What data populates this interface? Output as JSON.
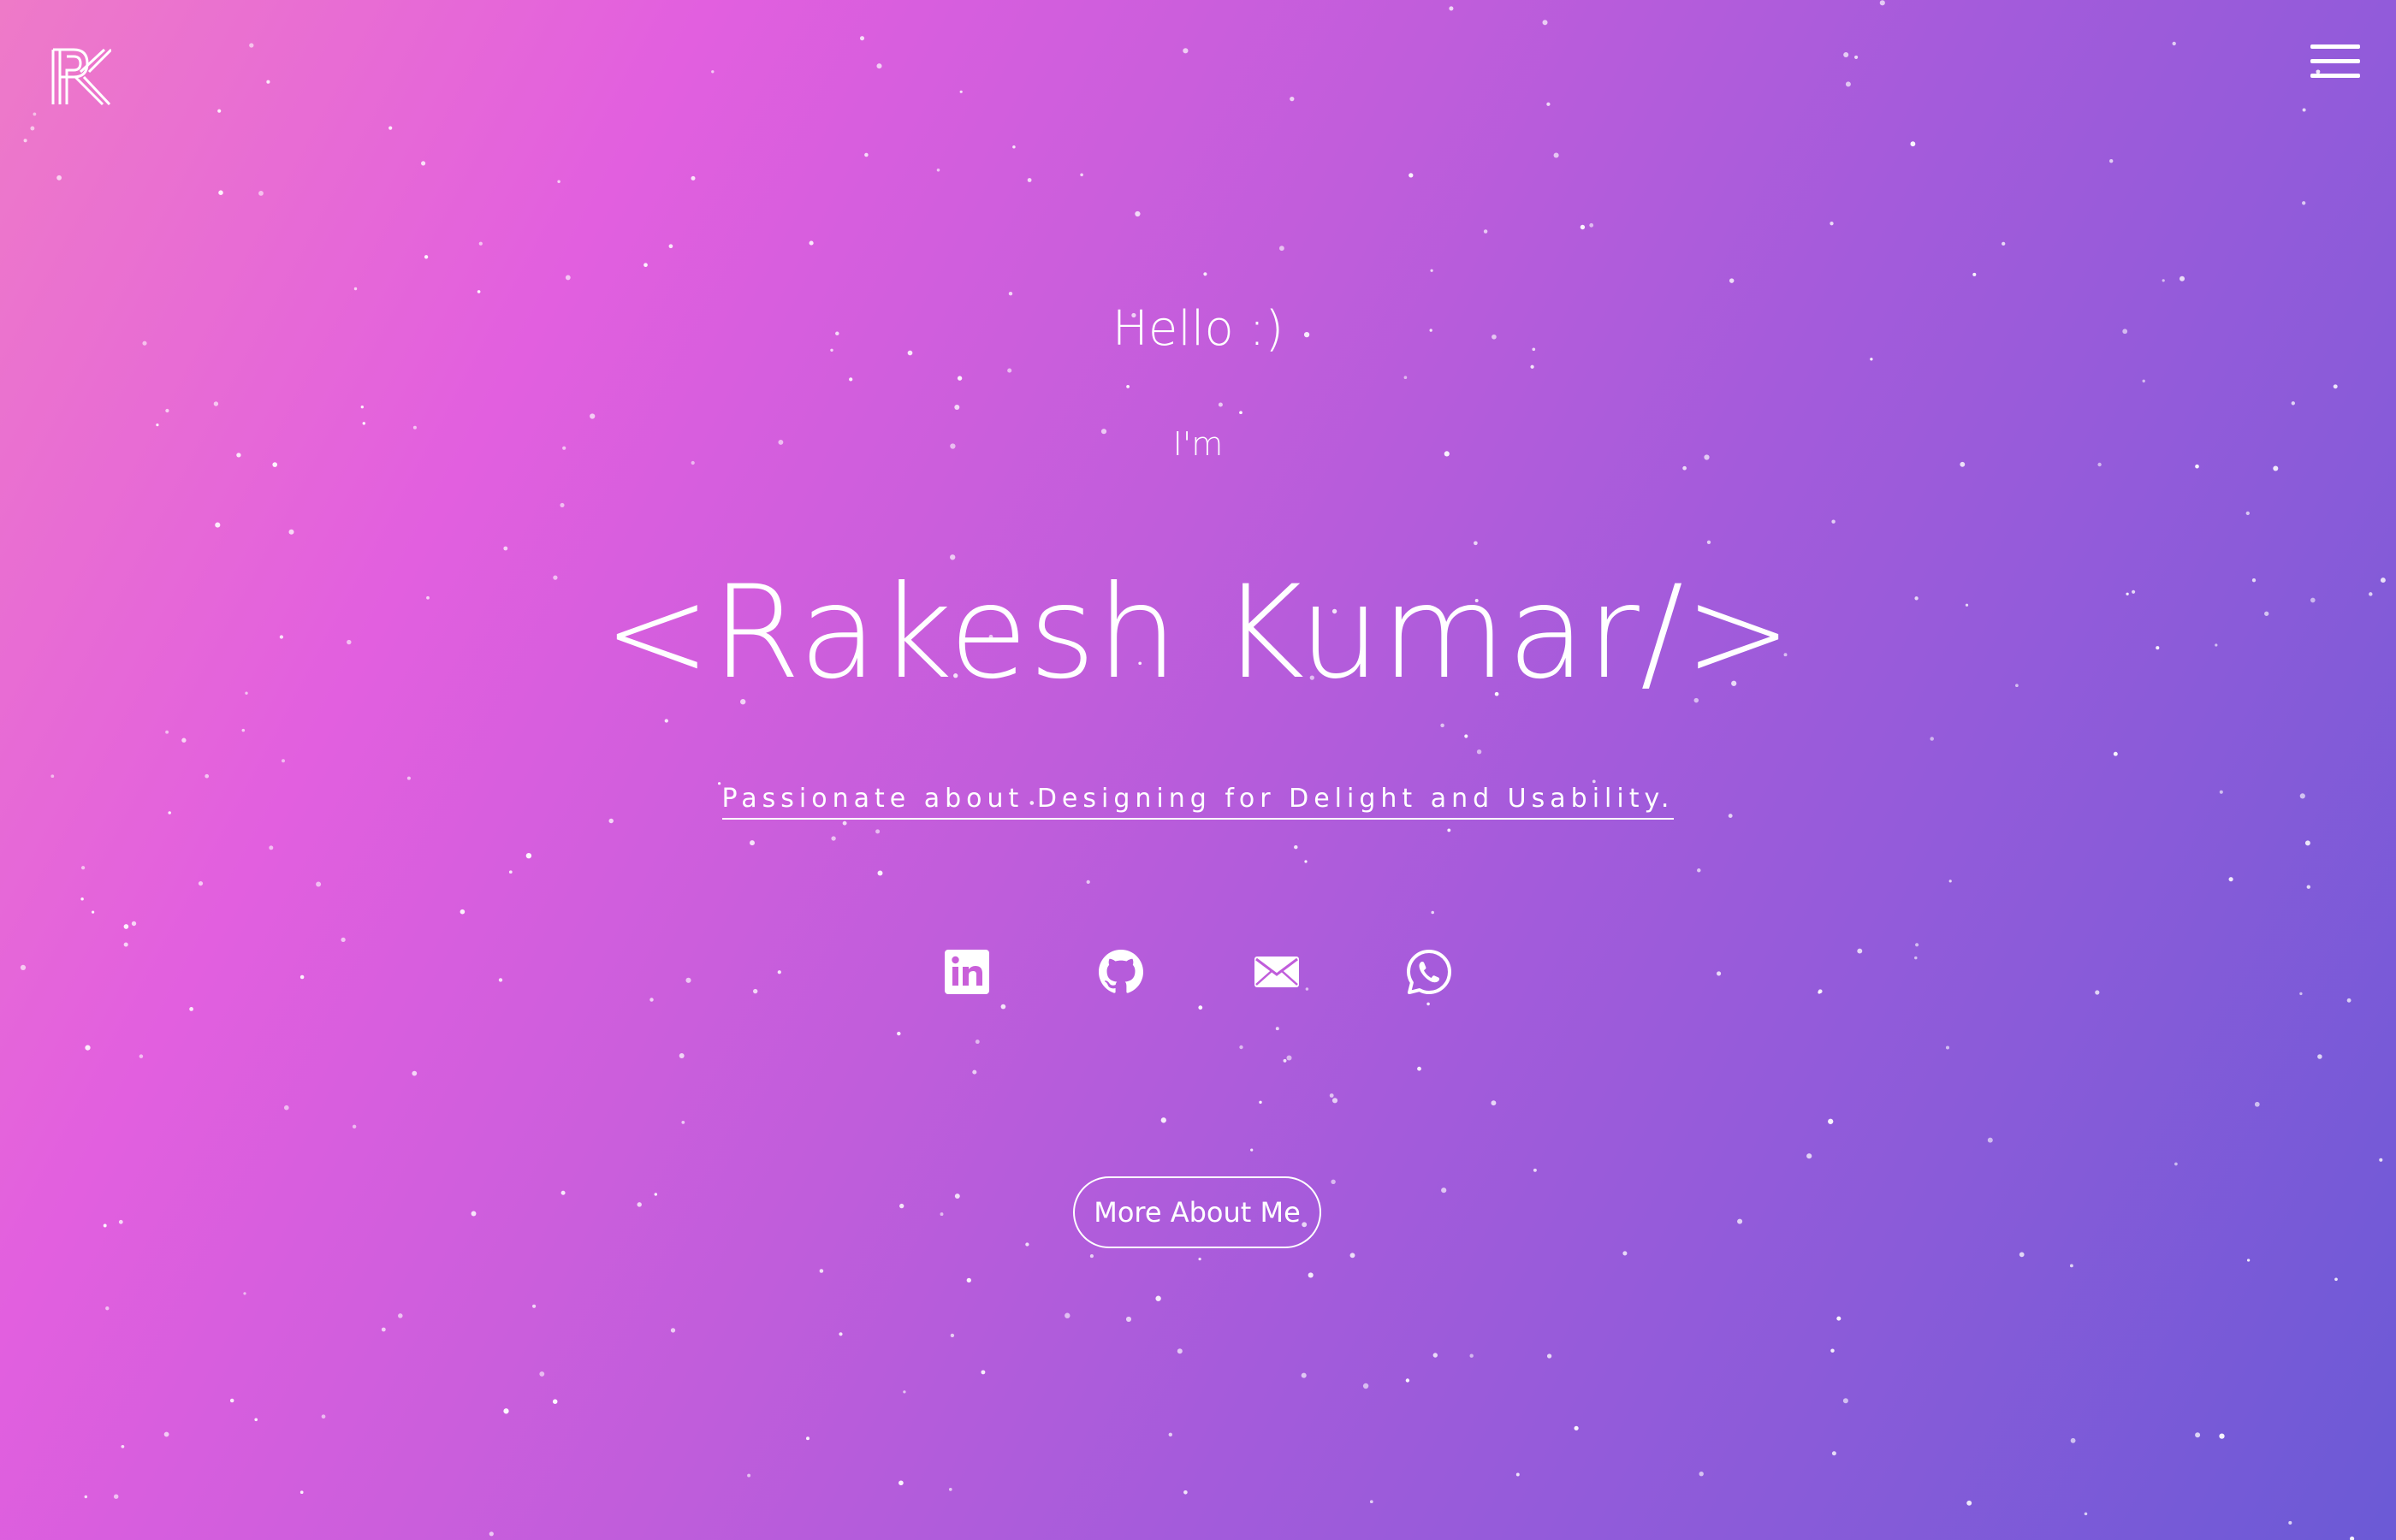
{
  "header": {
    "logo_icon": "rk-monogram-logo",
    "menu_icon": "hamburger-menu-icon"
  },
  "hero": {
    "greeting": "Hello :)",
    "intro": "I'm",
    "name": "<Rakesh Kumar/>",
    "tagline": "Passionate about Designing for Delight and Usability."
  },
  "socials": [
    {
      "icon": "linkedin-icon"
    },
    {
      "icon": "github-icon"
    },
    {
      "icon": "email-icon"
    },
    {
      "icon": "whatsapp-icon"
    }
  ],
  "cta": {
    "label": "More About Me"
  },
  "colors": {
    "gradient_start": "#ee7ac8",
    "gradient_mid": "#e25fdf",
    "gradient_end": "#6b5ad6",
    "foreground": "#ffffff"
  }
}
